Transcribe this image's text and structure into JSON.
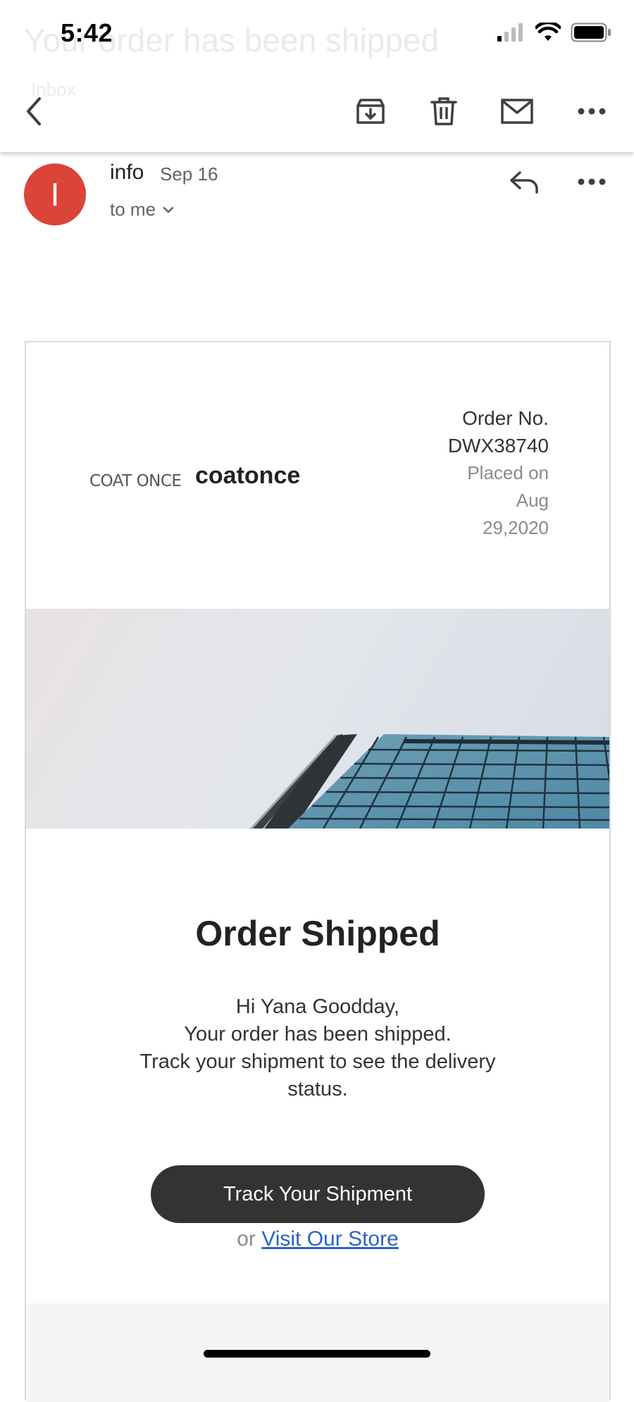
{
  "status_bar": {
    "time": "5:42"
  },
  "toolbar": {
    "ghost_subject": "Your order has been shipped",
    "ghost_label": "Inbox"
  },
  "sender": {
    "initial": "I",
    "name": "info",
    "date": "Sep 16",
    "recipient": "to me"
  },
  "email": {
    "brand_logo_text": "COAT ONCE",
    "brand_name": "coatonce",
    "order_label": "Order No.",
    "order_number": "DWX38740",
    "placed_line1": "Placed on",
    "placed_line2": "Aug",
    "placed_line3": "29,2020",
    "headline": "Order Shipped",
    "greeting_line1": "Hi Yana Goodday,",
    "greeting_line2": "Your order has been shipped.",
    "greeting_line3": "Track your shipment to see the delivery status.",
    "track_button": "Track Your Shipment",
    "or_text": "or",
    "store_link": "Visit Our Store"
  },
  "colors": {
    "avatar": "#db4437",
    "button": "#333333",
    "link": "#2a63c4"
  },
  "icons": {
    "back": "chevron-left-icon",
    "archive": "archive-icon",
    "delete": "trash-icon",
    "mark_unread": "mail-icon",
    "more": "more-horizontal-icon",
    "reply": "reply-icon"
  }
}
